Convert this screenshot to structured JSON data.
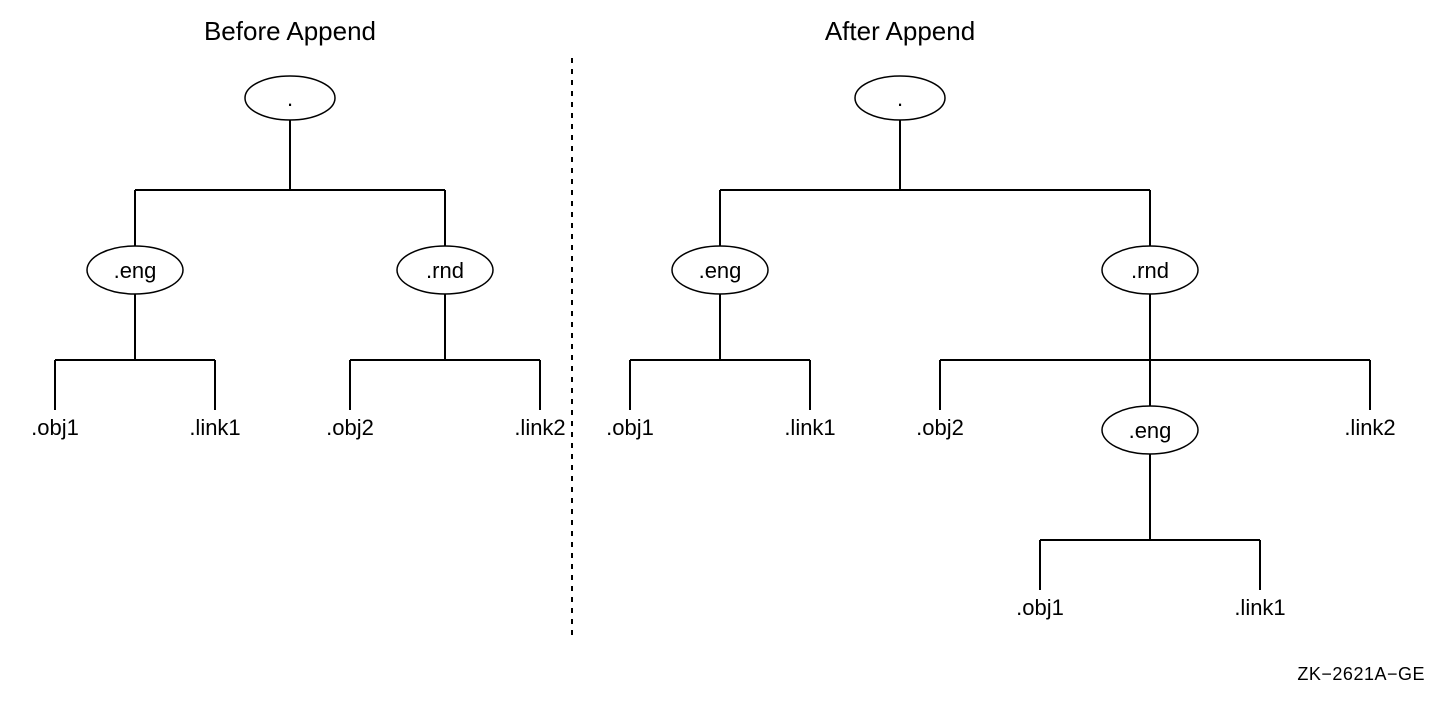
{
  "titles": {
    "before": "Before Append",
    "after": "After Append"
  },
  "nodes": {
    "root": ".",
    "eng": ".eng",
    "rnd": ".rnd",
    "obj1": ".obj1",
    "link1": ".link1",
    "obj2": ".obj2",
    "link2": ".link2"
  },
  "footer": "ZK−2621A−GE"
}
